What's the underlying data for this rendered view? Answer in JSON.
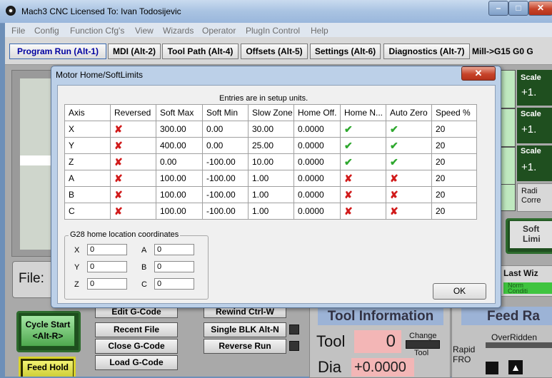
{
  "window": {
    "title": "Mach3 CNC  Licensed To: Ivan Todosijevic"
  },
  "menu": [
    "File",
    "Config",
    "Function Cfg's",
    "View",
    "Wizards",
    "Operator",
    "PlugIn Control",
    "Help"
  ],
  "tabs": [
    "Program Run (Alt-1)",
    "MDI (Alt-2)",
    "Tool Path (Alt-4)",
    "Offsets (Alt-5)",
    "Settings (Alt-6)",
    "Diagnostics (Alt-7)"
  ],
  "status_right": "Mill->G15  G0 G",
  "dialog": {
    "title": "Motor Home/SoftLimits",
    "close_label": "✕",
    "caption": "Entries are in setup units.",
    "columns": [
      "Axis",
      "Reversed",
      "Soft Max",
      "Soft Min",
      "Slow Zone",
      "Home Off.",
      "Home N...",
      "Auto Zero",
      "Speed %"
    ],
    "rows": [
      {
        "axis": "X",
        "reversed": false,
        "soft_max": "300.00",
        "soft_min": "0.00",
        "slow_zone": "30.00",
        "home_off": "0.0000",
        "home_neg": true,
        "auto_zero": true,
        "speed": "20"
      },
      {
        "axis": "Y",
        "reversed": false,
        "soft_max": "400.00",
        "soft_min": "0.00",
        "slow_zone": "25.00",
        "home_off": "0.0000",
        "home_neg": true,
        "auto_zero": true,
        "speed": "20"
      },
      {
        "axis": "Z",
        "reversed": false,
        "soft_max": "0.00",
        "soft_min": "-100.00",
        "slow_zone": "10.00",
        "home_off": "0.0000",
        "home_neg": true,
        "auto_zero": true,
        "speed": "20"
      },
      {
        "axis": "A",
        "reversed": false,
        "soft_max": "100.00",
        "soft_min": "-100.00",
        "slow_zone": "1.00",
        "home_off": "0.0000",
        "home_neg": false,
        "auto_zero": false,
        "speed": "20"
      },
      {
        "axis": "B",
        "reversed": false,
        "soft_max": "100.00",
        "soft_min": "-100.00",
        "slow_zone": "1.00",
        "home_off": "0.0000",
        "home_neg": false,
        "auto_zero": false,
        "speed": "20"
      },
      {
        "axis": "C",
        "reversed": false,
        "soft_max": "100.00",
        "soft_min": "-100.00",
        "slow_zone": "1.00",
        "home_off": "0.0000",
        "home_neg": false,
        "auto_zero": false,
        "speed": "20"
      }
    ],
    "g28": {
      "label": "G28 home location coordinates",
      "fields": [
        {
          "axis": "X",
          "value": "0"
        },
        {
          "axis": "Y",
          "value": "0"
        },
        {
          "axis": "Z",
          "value": "0"
        },
        {
          "axis": "A",
          "value": "0"
        },
        {
          "axis": "B",
          "value": "0"
        },
        {
          "axis": "C",
          "value": "0"
        }
      ]
    },
    "ok_label": "OK"
  },
  "background": {
    "file_label": "File:",
    "cycle_start": "Cycle Start\n<Alt-R>",
    "feed_hold": "Feed Hold",
    "edit_gcode": "Edit G-Code",
    "recent_file": "Recent File",
    "close_gcode": "Close G-Code",
    "load_gcode": "Load G-Code",
    "rewind": "Rewind Ctrl-W",
    "single_blk": "Single BLK Alt-N",
    "reverse_run": "Reverse Run",
    "tool_information": "Tool Information",
    "tool_label": "Tool",
    "tool_value": "0",
    "change_label": "Change",
    "tool_small": "Tool",
    "dia_label": "Dia",
    "dia_value": "+0.0000",
    "feed_rate": "Feed Ra",
    "overridden": "OverRidden",
    "rapid_fro": "Rapid\nFRO",
    "scale_label": "Scale",
    "scale_value": "+1.",
    "radius_corr": "Radi\nCorre",
    "soft_limits": "Soft\nLimi",
    "last_wiz": "Last Wiz",
    "normal_cond": "Norm\nConditi"
  },
  "colors": {
    "dialog_frame": "#bcd0e8",
    "close_red": "#c7442a",
    "check_green": "#2ea82e",
    "x_red": "#d11a1a"
  }
}
